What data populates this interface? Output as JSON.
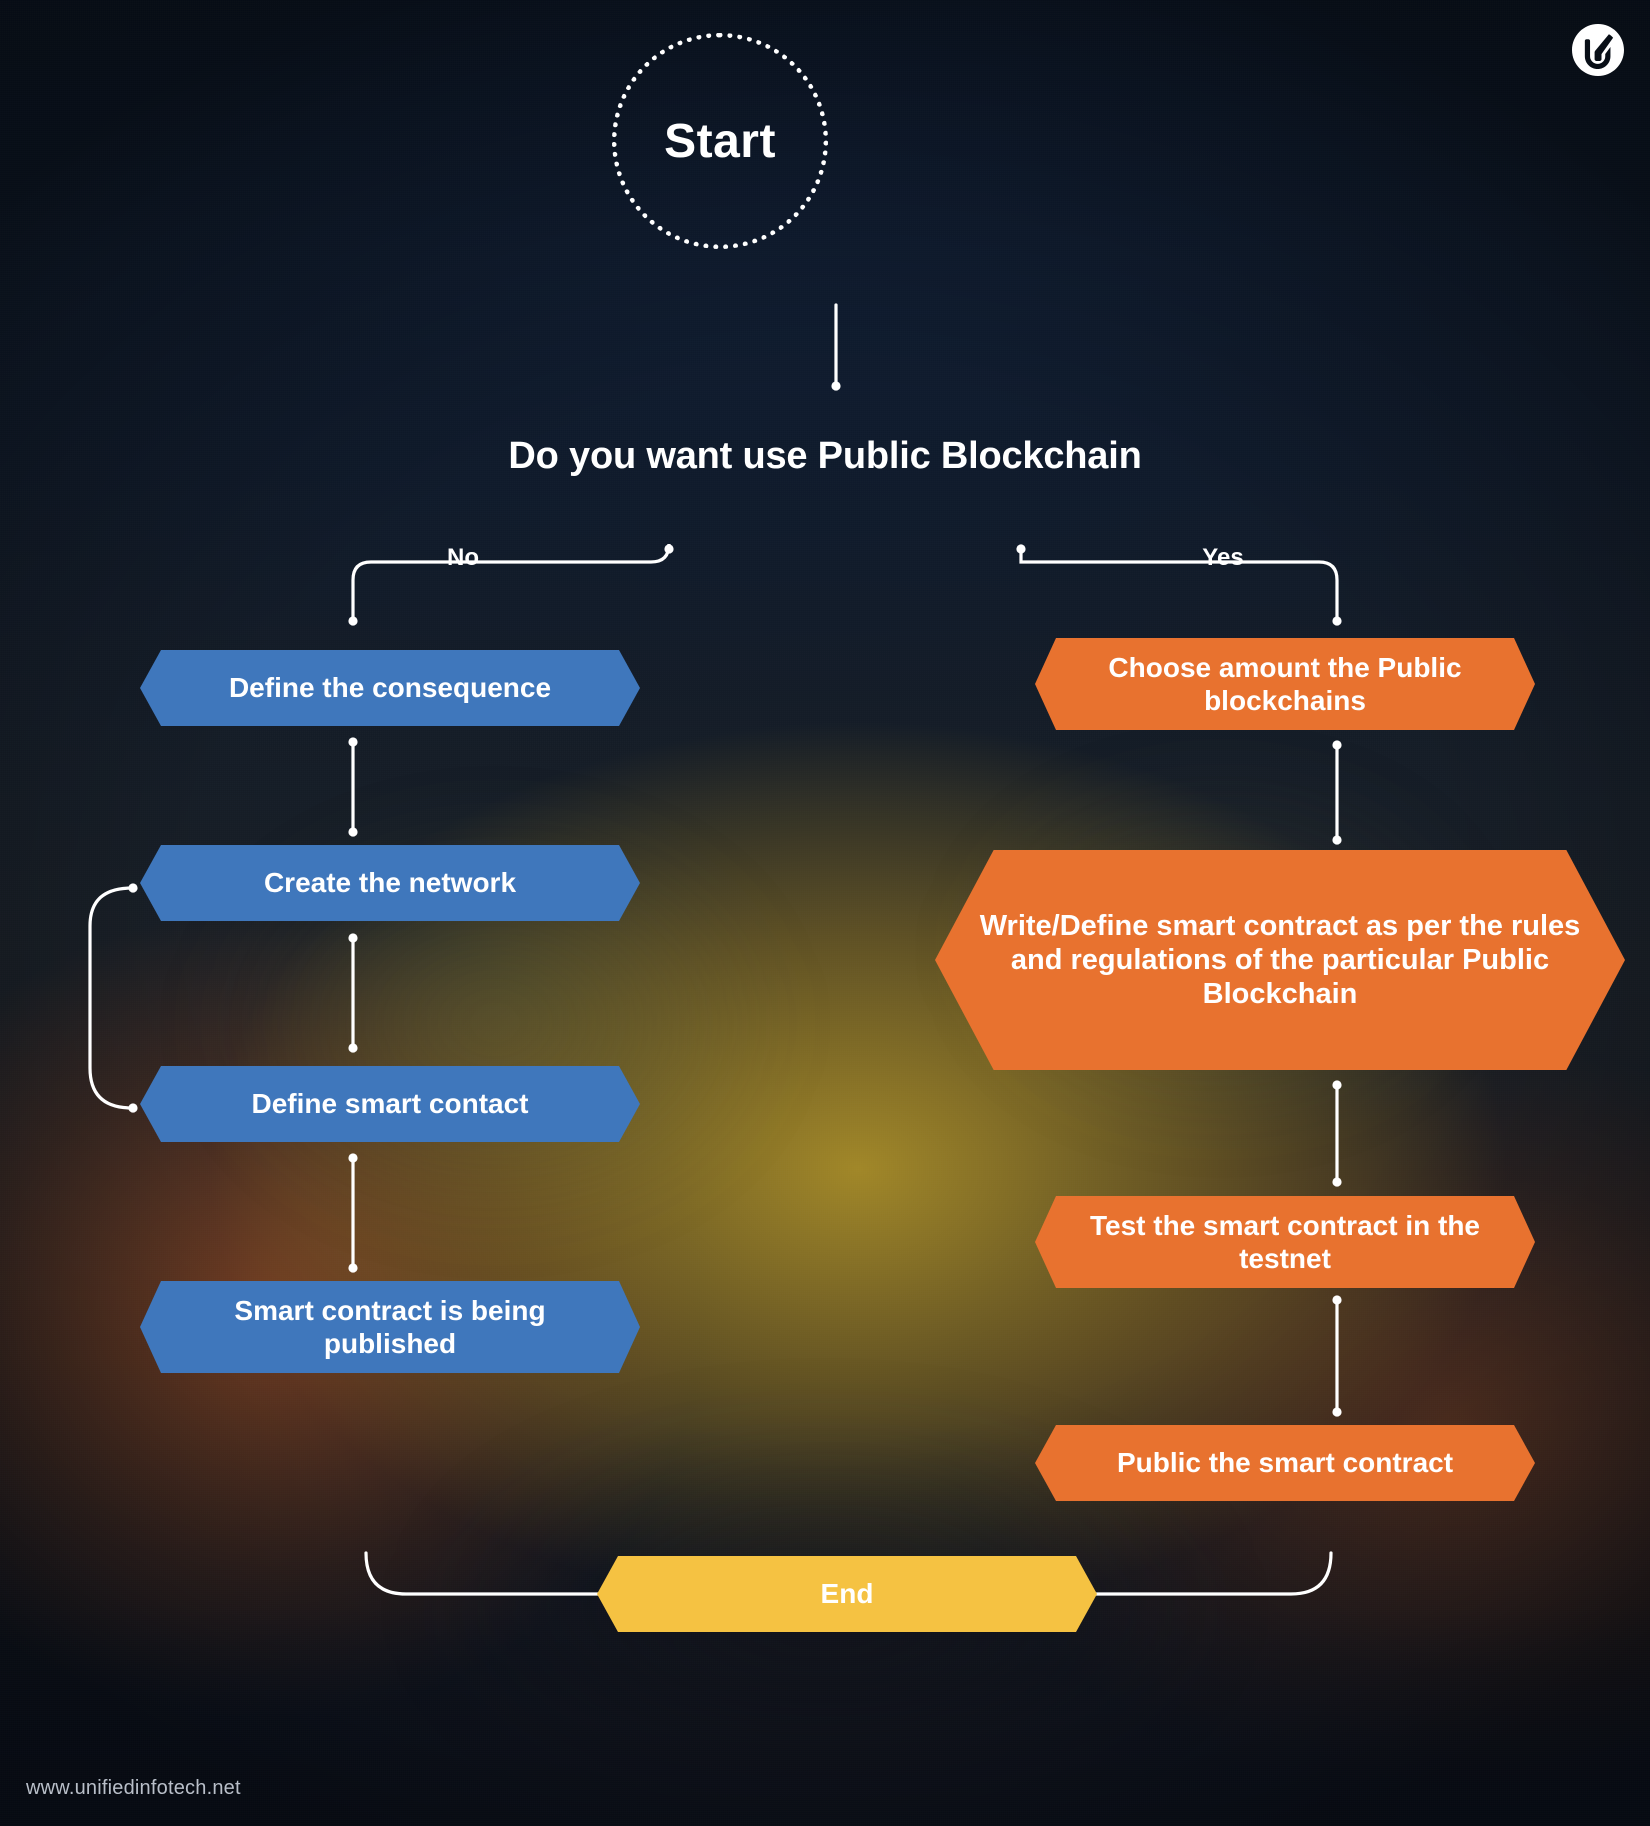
{
  "brand": {
    "logo_icon": "unified-infotech-u-logo",
    "footer_url": "www.unifiedinfotech.net"
  },
  "flow": {
    "start_label": "Start",
    "question": "Do you want use Public Blockchain",
    "branch_no_label": "No",
    "branch_yes_label": "Yes",
    "end_label": "End",
    "no_branch": [
      {
        "label": "Define the consequence"
      },
      {
        "label": "Create the network"
      },
      {
        "label": "Define smart contact"
      },
      {
        "label": "Smart contract is being published"
      }
    ],
    "yes_branch": [
      {
        "label": "Choose amount the Public blockchains"
      },
      {
        "label": "Write/Define smart contract as per the rules and regulations of the particular Public Blockchain"
      },
      {
        "label": "Test the smart contract in the testnet"
      },
      {
        "label": "Public the smart contract"
      }
    ]
  },
  "colors": {
    "blue": "#3f77bc",
    "orange": "#e8722f",
    "gold": "#f5c242",
    "connector": "#ffffff",
    "text": "#ffffff",
    "background_top": "#0f1c2e"
  }
}
